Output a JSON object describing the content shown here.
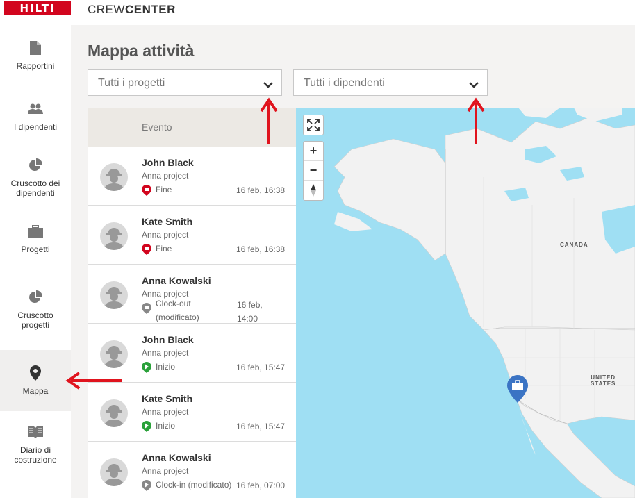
{
  "header": {
    "logo_text": "HILTI",
    "brand_prefix": "CREW",
    "brand_suffix": "CENTER"
  },
  "sidebar": {
    "items": [
      {
        "label": "Rapportini",
        "icon": "document-icon"
      },
      {
        "label": "I dipendenti",
        "icon": "people-icon"
      },
      {
        "label": "Cruscotto dei dipendenti",
        "icon": "pie-chart-icon"
      },
      {
        "label": "Progetti",
        "icon": "briefcase-icon"
      },
      {
        "label": "Cruscotto progetti",
        "icon": "pie-chart-icon"
      },
      {
        "label": "Mappa",
        "icon": "map-pin-icon",
        "active": true
      },
      {
        "label": "Diario di costruzione",
        "icon": "book-icon"
      }
    ]
  },
  "main": {
    "title": "Mappa attività",
    "project_select": "Tutti i progetti",
    "employee_select": "Tutti i dipendenti",
    "list_header": "Evento",
    "events": [
      {
        "name": "John Black",
        "project": "Anna project",
        "status": "Fine",
        "time": "16 feb, 16:38",
        "pin": "red"
      },
      {
        "name": "Kate Smith",
        "project": "Anna project",
        "status": "Fine",
        "time": "16 feb, 16:38",
        "pin": "red"
      },
      {
        "name": "Anna Kowalski",
        "project": "Anna project",
        "status_line1": "Clock-out",
        "status_line2": "(modificato)",
        "time_line1": "16 feb,",
        "time_line2": "14:00",
        "pin": "gray"
      },
      {
        "name": "John Black",
        "project": "Anna project",
        "status": "Inizio",
        "time": "16 feb, 15:47",
        "pin": "green"
      },
      {
        "name": "Kate Smith",
        "project": "Anna project",
        "status": "Inizio",
        "time": "16 feb, 15:47",
        "pin": "green"
      },
      {
        "name": "Anna Kowalski",
        "project": "Anna project",
        "status": "Clock-in (modificato)",
        "time": "16 feb, 07:00",
        "pin": "gray"
      }
    ]
  },
  "map": {
    "zoom_in": "+",
    "zoom_out": "−",
    "labels": {
      "canada": "CANADA",
      "united_states_1": "UNITED",
      "united_states_2": "STATES"
    },
    "colors": {
      "water": "#9fdff3",
      "land": "#f2f2f2",
      "marker": "#3b74c4"
    }
  },
  "colors": {
    "brand": "#d2051e",
    "annotation_arrow": "#e0141e"
  }
}
